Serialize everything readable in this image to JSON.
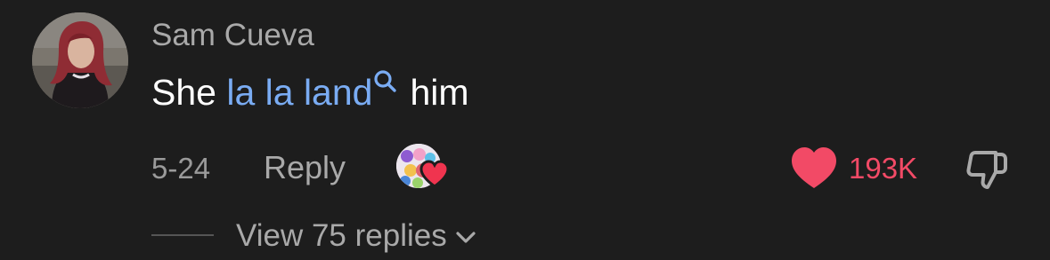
{
  "comment": {
    "username": "Sam Cueva",
    "text_before": "She ",
    "text_link": "la la land",
    "text_after": "him",
    "date": "5-24",
    "reply_label": "Reply",
    "like_count": "193K",
    "liked": true,
    "creator_liked": true,
    "view_replies_label": "View 75 replies"
  },
  "icons": {
    "search": "search-icon",
    "like": "heart-icon",
    "dislike": "thumbs-down-icon",
    "chevron": "chevron-down-icon",
    "creator_heart": "heart-icon"
  },
  "colors": {
    "background": "#1d1d1d",
    "link": "#7aacf3",
    "like": "#f24a66",
    "muted_text": "#a9a9a9",
    "primary_text": "#ffffff"
  }
}
